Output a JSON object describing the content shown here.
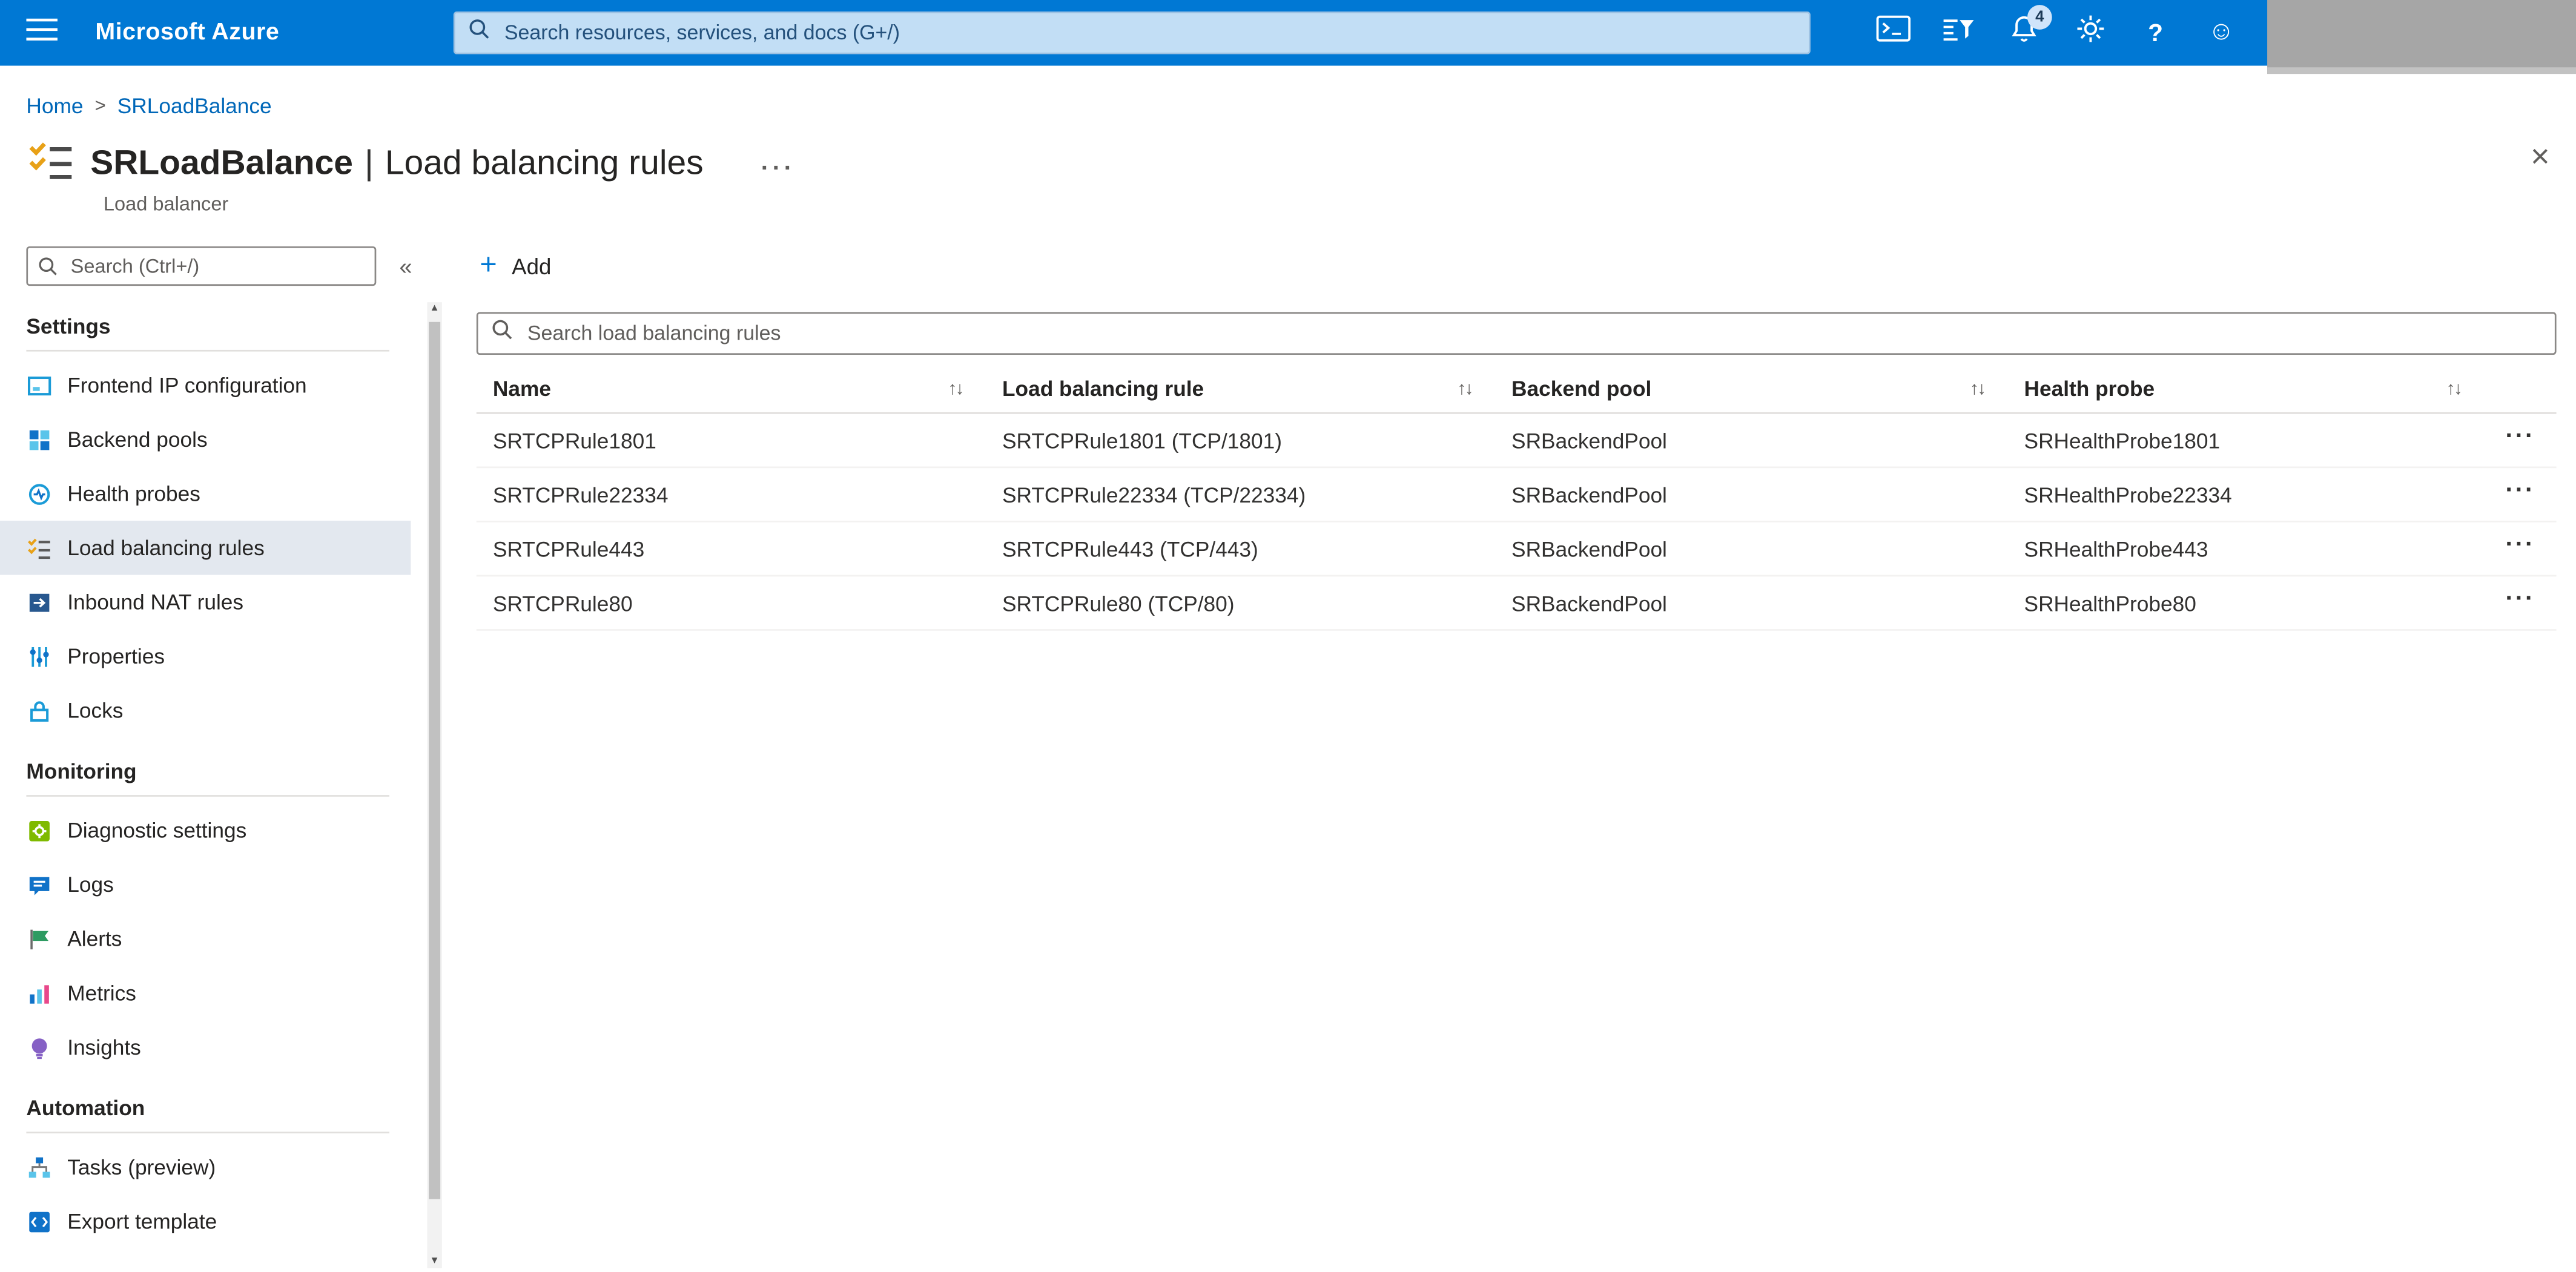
{
  "topbar": {
    "brand": "Microsoft Azure",
    "search": {
      "placeholder": "Search resources, services, and docs (G+/)"
    },
    "notifications_badge": "4",
    "help_glyph": "?",
    "smiley_glyph": "☺"
  },
  "breadcrumb": {
    "home": "Home",
    "separator": ">",
    "current": "SRLoadBalance"
  },
  "header": {
    "resource_name": "SRLoadBalance",
    "divider": "|",
    "page_title": "Load balancing rules",
    "resource_type": "Load balancer",
    "more_glyph": "···",
    "close_glyph": "×"
  },
  "sidebar": {
    "search_placeholder": "Search (Ctrl+/)",
    "collapse_glyph": "«",
    "scrollbar": {
      "up": "▲",
      "down": "▼"
    },
    "sections": [
      {
        "title": "Settings",
        "items": [
          {
            "label": "Frontend IP configuration",
            "icon": "frontend-ip-icon"
          },
          {
            "label": "Backend pools",
            "icon": "backend-pools-icon"
          },
          {
            "label": "Health probes",
            "icon": "health-probes-icon"
          },
          {
            "label": "Load balancing rules",
            "icon": "load-balancing-rules-icon",
            "selected": true
          },
          {
            "label": "Inbound NAT rules",
            "icon": "inbound-nat-icon"
          },
          {
            "label": "Properties",
            "icon": "properties-icon"
          },
          {
            "label": "Locks",
            "icon": "locks-icon"
          }
        ]
      },
      {
        "title": "Monitoring",
        "items": [
          {
            "label": "Diagnostic settings",
            "icon": "diagnostic-settings-icon"
          },
          {
            "label": "Logs",
            "icon": "logs-icon"
          },
          {
            "label": "Alerts",
            "icon": "alerts-icon"
          },
          {
            "label": "Metrics",
            "icon": "metrics-icon"
          },
          {
            "label": "Insights",
            "icon": "insights-icon"
          }
        ]
      },
      {
        "title": "Automation",
        "items": [
          {
            "label": "Tasks (preview)",
            "icon": "tasks-icon"
          },
          {
            "label": "Export template",
            "icon": "export-template-icon"
          }
        ]
      }
    ]
  },
  "main": {
    "add_label": "Add",
    "search_placeholder": "Search load balancing rules",
    "sort_glyph": "↑↓",
    "row_menu_glyph": "···",
    "table": {
      "columns": [
        "Name",
        "Load balancing rule",
        "Backend pool",
        "Health probe"
      ],
      "rows": [
        {
          "name": "SRTCPRule1801",
          "rule": "SRTCPRule1801 (TCP/1801)",
          "backend_pool": "SRBackendPool",
          "health_probe": "SRHealthProbe1801"
        },
        {
          "name": "SRTCPRule22334",
          "rule": "SRTCPRule22334 (TCP/22334)",
          "backend_pool": "SRBackendPool",
          "health_probe": "SRHealthProbe22334"
        },
        {
          "name": "SRTCPRule443",
          "rule": "SRTCPRule443 (TCP/443)",
          "backend_pool": "SRBackendPool",
          "health_probe": "SRHealthProbe443"
        },
        {
          "name": "SRTCPRule80",
          "rule": "SRTCPRule80 (TCP/80)",
          "backend_pool": "SRBackendPool",
          "health_probe": "SRHealthProbe80"
        }
      ]
    }
  }
}
